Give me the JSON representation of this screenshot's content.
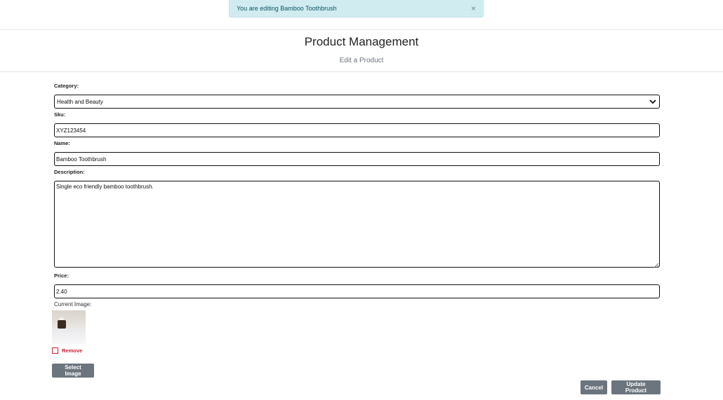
{
  "alert": {
    "message": "You are editing Bamboo Toothbrush",
    "close_symbol": "×"
  },
  "header": {
    "title": "Product Management",
    "subtitle": "Edit a Product"
  },
  "form": {
    "category": {
      "label": "Category:",
      "value": "Health and Beauty"
    },
    "sku": {
      "label": "Sku:",
      "value": "XYZ123454"
    },
    "name": {
      "label": "Name:",
      "value": "Bamboo Toothbrush"
    },
    "description": {
      "label": "Description:",
      "value": "Single eco friendly bamboo toothbrush."
    },
    "price": {
      "label": "Price:",
      "value": "2.40"
    },
    "current_image": {
      "label": "Current Image:",
      "remove_label": "Remove",
      "remove_checked": false
    },
    "select_image_label": "Select Image",
    "cancel_label": "Cancel",
    "submit_label": "Update Product"
  },
  "colors": {
    "alert_bg": "#d1ecf1",
    "alert_text": "#0c5460",
    "button_bg": "#6c757d",
    "danger": "#c82333"
  }
}
